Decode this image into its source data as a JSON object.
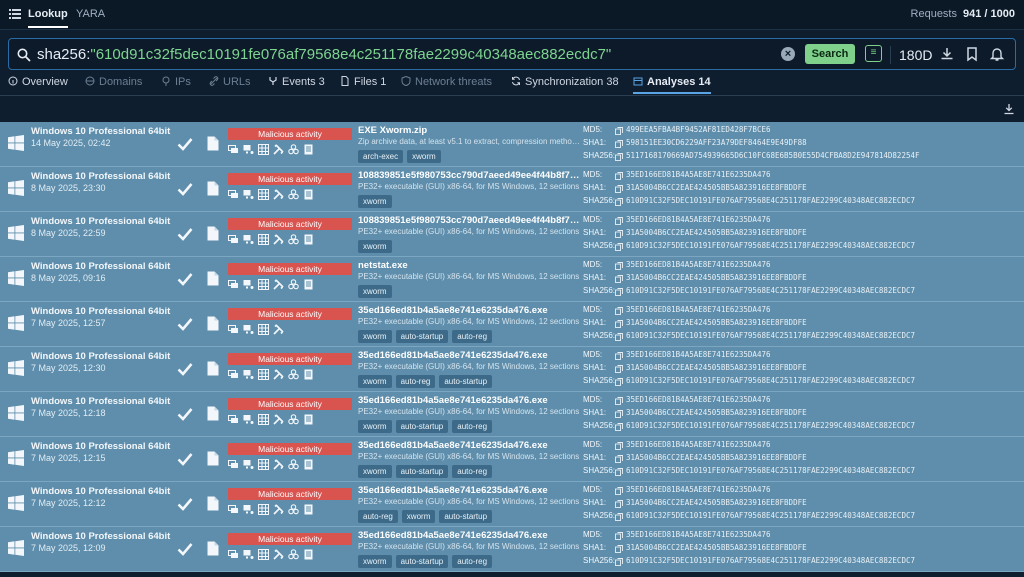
{
  "topbar": {
    "tabs": [
      {
        "label": "Lookup",
        "active": true
      },
      {
        "label": "YARA",
        "active": false
      }
    ],
    "requests_label": "Requests",
    "requests_value": "941 / 1000"
  },
  "search": {
    "prefix": "sha256:",
    "hash": "\"610d91c32f5dec10191fe076af79568e4c251178fae2299c40348aec882ecdc7\"",
    "button_label": "Search",
    "period": "180D"
  },
  "nav_tabs": [
    {
      "label": "Overview",
      "icon": "info-icon",
      "state": "normal"
    },
    {
      "label": "Domains",
      "icon": "globe-icon",
      "state": "dim"
    },
    {
      "label": "IPs",
      "icon": "pin-icon",
      "state": "dim"
    },
    {
      "label": "URLs",
      "icon": "link-icon",
      "state": "dim"
    },
    {
      "label": "Events 3",
      "icon": "fork-icon",
      "state": "normal"
    },
    {
      "label": "Files 1",
      "icon": "file-icon",
      "state": "normal"
    },
    {
      "label": "Network threats",
      "icon": "shield-icon",
      "state": "dim"
    },
    {
      "label": "Synchronization 38",
      "icon": "sync-icon",
      "state": "normal"
    },
    {
      "label": "Analyses 14",
      "icon": "calendar-icon",
      "state": "active"
    }
  ],
  "hash_labels": {
    "md5": "MD5:",
    "sha1": "SHA1:",
    "sha256": "SHA256:"
  },
  "rows": [
    {
      "os": "Windows 10 Professional 64bit",
      "date": "14 May 2025, 02:42",
      "verdict": "Malicious activity",
      "tools": 6,
      "filename": "EXE Xworm.zip",
      "filetype": "Zip archive data, at least v5.1 to extract, compression method...",
      "tags": [
        "arch-exec",
        "xworm"
      ],
      "md5": "499EEA5FBA4BF9452AF81ED428F7BCE6",
      "sha1": "598151EE30CD6229AFF23A79DEF8464E9E49DF88",
      "sha256": "5117168170669AD754939665D6C10FC68E6B5B0E55D4CFBA8D2E947814D82254F"
    },
    {
      "os": "Windows 10 Professional 64bit",
      "date": "8 May 2025, 23:30",
      "verdict": "Malicious activity",
      "tools": 6,
      "filename": "108839851e5f980753cc790d7aeed49ee4f44b8f7752...",
      "filetype": "PE32+ executable (GUI) x86-64, for MS Windows, 12 sections",
      "tags": [
        "xworm"
      ],
      "md5": "35ED166ED81B4A5AE8E741E6235DA476",
      "sha1": "31A5004B6CC2EAE424505BB5A823916EE8FBDDFE",
      "sha256": "610D91C32F5DEC10191FE076AF79568E4C251178FAE2299C40348AEC882ECDC7"
    },
    {
      "os": "Windows 10 Professional 64bit",
      "date": "8 May 2025, 22:59",
      "verdict": "Malicious activity",
      "tools": 6,
      "filename": "108839851e5f980753cc790d7aeed49ee4f44b8f7752...",
      "filetype": "PE32+ executable (GUI) x86-64, for MS Windows, 12 sections",
      "tags": [
        "xworm"
      ],
      "md5": "35ED166ED81B4A5AE8E741E6235DA476",
      "sha1": "31A5004B6CC2EAE424505BB5A823916EE8FBDDFE",
      "sha256": "610D91C32F5DEC10191FE076AF79568E4C251178FAE2299C40348AEC882ECDC7"
    },
    {
      "os": "Windows 10 Professional 64bit",
      "date": "8 May 2025, 09:16",
      "verdict": "Malicious activity",
      "tools": 6,
      "filename": "netstat.exe",
      "filetype": "PE32+ executable (GUI) x86-64, for MS Windows, 12 sections",
      "tags": [
        "xworm"
      ],
      "md5": "35ED166ED81B4A5AE8E741E6235DA476",
      "sha1": "31A5004B6CC2EAE424505BB5A823916EE8FBDDFE",
      "sha256": "610D91C32F5DEC10191FE076AF79568E4C251178FAE2299C40348AEC882ECDC7"
    },
    {
      "os": "Windows 10 Professional 64bit",
      "date": "7 May 2025, 12:57",
      "verdict": "Malicious activity",
      "tools": 4,
      "filename": "35ed166ed81b4a5ae8e741e6235da476.exe",
      "filetype": "PE32+ executable (GUI) x86-64, for MS Windows, 12 sections",
      "tags": [
        "xworm",
        "auto-startup",
        "auto-reg"
      ],
      "md5": "35ED166ED81B4A5AE8E741E6235DA476",
      "sha1": "31A5004B6CC2EAE424505BB5A823916EE8FBDDFE",
      "sha256": "610D91C32F5DEC10191FE076AF79568E4C251178FAE2299C40348AEC882ECDC7"
    },
    {
      "os": "Windows 10 Professional 64bit",
      "date": "7 May 2025, 12:30",
      "verdict": "Malicious activity",
      "tools": 6,
      "filename": "35ed166ed81b4a5ae8e741e6235da476.exe",
      "filetype": "PE32+ executable (GUI) x86-64, for MS Windows, 12 sections",
      "tags": [
        "xworm",
        "auto-reg",
        "auto-startup"
      ],
      "md5": "35ED166ED81B4A5AE8E741E6235DA476",
      "sha1": "31A5004B6CC2EAE424505BB5A823916EE8FBDDFE",
      "sha256": "610D91C32F5DEC10191FE076AF79568E4C251178FAE2299C40348AEC882ECDC7"
    },
    {
      "os": "Windows 10 Professional 64bit",
      "date": "7 May 2025, 12:18",
      "verdict": "Malicious activity",
      "tools": 6,
      "filename": "35ed166ed81b4a5ae8e741e6235da476.exe",
      "filetype": "PE32+ executable (GUI) x86-64, for MS Windows, 12 sections",
      "tags": [
        "xworm",
        "auto-startup",
        "auto-reg"
      ],
      "md5": "35ED166ED81B4A5AE8E741E6235DA476",
      "sha1": "31A5004B6CC2EAE424505BB5A823916EE8FBDDFE",
      "sha256": "610D91C32F5DEC10191FE076AF79568E4C251178FAE2299C40348AEC882ECDC7"
    },
    {
      "os": "Windows 10 Professional 64bit",
      "date": "7 May 2025, 12:15",
      "verdict": "Malicious activity",
      "tools": 6,
      "filename": "35ed166ed81b4a5ae8e741e6235da476.exe",
      "filetype": "PE32+ executable (GUI) x86-64, for MS Windows, 12 sections",
      "tags": [
        "xworm",
        "auto-startup",
        "auto-reg"
      ],
      "md5": "35ED166ED81B4A5AE8E741E6235DA476",
      "sha1": "31A5004B6CC2EAE424505BB5A823916EE8FBDDFE",
      "sha256": "610D91C32F5DEC10191FE076AF79568E4C251178FAE2299C40348AEC882ECDC7"
    },
    {
      "os": "Windows 10 Professional 64bit",
      "date": "7 May 2025, 12:12",
      "verdict": "Malicious activity",
      "tools": 6,
      "filename": "35ed166ed81b4a5ae8e741e6235da476.exe",
      "filetype": "PE32+ executable (GUI) x86-64, for MS Windows, 12 sections",
      "tags": [
        "auto-reg",
        "xworm",
        "auto-startup"
      ],
      "md5": "35ED166ED81B4A5AE8E741E6235DA476",
      "sha1": "31A5004B6CC2EAE424505BB5A823916EE8FBDDFE",
      "sha256": "610D91C32F5DEC10191FE076AF79568E4C251178FAE2299C40348AEC882ECDC7"
    },
    {
      "os": "Windows 10 Professional 64bit",
      "date": "7 May 2025, 12:09",
      "verdict": "Malicious activity",
      "tools": 6,
      "filename": "35ed166ed81b4a5ae8e741e6235da476.exe",
      "filetype": "PE32+ executable (GUI) x86-64, for MS Windows, 12 sections",
      "tags": [
        "xworm",
        "auto-startup",
        "auto-reg"
      ],
      "md5": "35ED166ED81B4A5AE8E741E6235DA476",
      "sha1": "31A5004B6CC2EAE424505BB5A823916EE8FBDDFE",
      "sha256": "610D91C32F5DEC10191FE076AF79568E4C251178FAE2299C40348AEC882ECDC7"
    }
  ],
  "colors": {
    "accent": "#5aa4e6",
    "search_button": "#7fd08a",
    "malicious": "#d9534f",
    "row_bg": "#5e8eab",
    "background": "#0f1e2e"
  }
}
